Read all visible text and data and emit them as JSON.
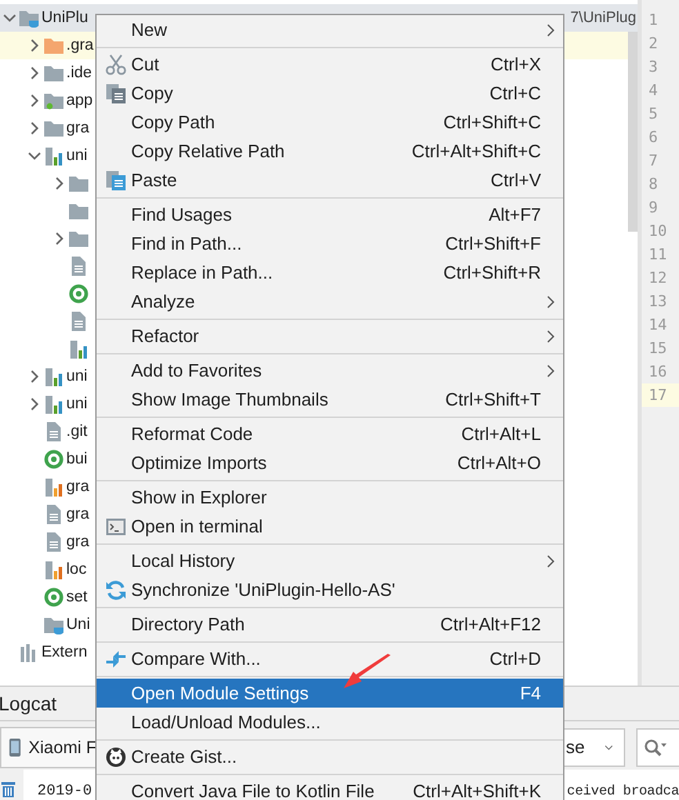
{
  "project_tree": {
    "items": [
      {
        "label": "UniPlu",
        "path_tail": "7\\UniPlug",
        "kind": "folder-cup",
        "expanded": true,
        "selected": true,
        "highlighted": false,
        "children": [
          {
            "label": ".gra",
            "kind": "folder-orange",
            "expanded": false,
            "selected": false,
            "highlighted": true
          },
          {
            "label": ".ide",
            "kind": "folder",
            "expanded": false,
            "selected": false,
            "highlighted": false
          },
          {
            "label": "app",
            "kind": "folder-app",
            "expanded": false,
            "selected": false,
            "highlighted": false
          },
          {
            "label": "gra",
            "kind": "folder",
            "expanded": false,
            "selected": false,
            "highlighted": false
          },
          {
            "label": "uni",
            "kind": "module",
            "expanded": true,
            "selected": false,
            "highlighted": false,
            "children": [
              {
                "kind": "folder",
                "expanded": false,
                "selected": false,
                "highlighted": false
              },
              {
                "kind": "folder",
                "selected": false,
                "highlighted": false
              },
              {
                "kind": "folder",
                "expanded": false,
                "selected": false,
                "highlighted": false
              },
              {
                "kind": "file",
                "selected": false,
                "highlighted": false
              },
              {
                "kind": "gradle",
                "selected": false,
                "highlighted": false
              },
              {
                "kind": "file",
                "selected": false,
                "highlighted": false
              },
              {
                "kind": "module",
                "selected": false,
                "highlighted": false
              }
            ]
          },
          {
            "label": "uni",
            "kind": "module",
            "expanded": false,
            "selected": false,
            "highlighted": false
          },
          {
            "label": "uni",
            "kind": "module",
            "expanded": false,
            "selected": false,
            "highlighted": false
          },
          {
            "label": ".git",
            "kind": "file",
            "selected": false,
            "highlighted": false
          },
          {
            "label": "bui",
            "kind": "gradle",
            "selected": false,
            "highlighted": false
          },
          {
            "label": "gra",
            "kind": "bars-orange",
            "selected": false,
            "highlighted": false
          },
          {
            "label": "gra",
            "kind": "file",
            "selected": false,
            "highlighted": false
          },
          {
            "label": "gra",
            "kind": "file",
            "selected": false,
            "highlighted": false
          },
          {
            "label": "loc",
            "kind": "bars-orange",
            "selected": false,
            "highlighted": false
          },
          {
            "label": "set",
            "kind": "gradle",
            "selected": false,
            "highlighted": false
          },
          {
            "label": "Uni",
            "kind": "folder-cup",
            "selected": false,
            "highlighted": false
          }
        ]
      },
      {
        "label": "Extern",
        "kind": "library",
        "selected": false,
        "highlighted": false
      }
    ]
  },
  "line_numbers": [
    {
      "number": "1",
      "current": false
    },
    {
      "number": "2",
      "current": false
    },
    {
      "number": "3",
      "current": false
    },
    {
      "number": "4",
      "current": false
    },
    {
      "number": "5",
      "current": false
    },
    {
      "number": "6",
      "current": false
    },
    {
      "number": "7",
      "current": false
    },
    {
      "number": "8",
      "current": false
    },
    {
      "number": "9",
      "current": false
    },
    {
      "number": "10",
      "current": false
    },
    {
      "number": "11",
      "current": false
    },
    {
      "number": "12",
      "current": false
    },
    {
      "number": "13",
      "current": false
    },
    {
      "number": "14",
      "current": false
    },
    {
      "number": "15",
      "current": false
    },
    {
      "number": "16",
      "current": false
    },
    {
      "number": "17",
      "current": true
    }
  ],
  "logcat": {
    "title": "Logcat",
    "device": "Xiaomi F",
    "filter": "se",
    "log_line": {
      "start": "2019-0",
      "end": "ceived broadca"
    }
  },
  "context_menu": {
    "groups": [
      [
        {
          "label": "New",
          "submenu": true,
          "selected": false
        }
      ],
      [
        {
          "label": "Cut",
          "shortcut": "Ctrl+X",
          "kind": "scissors",
          "submenu": false,
          "selected": false
        },
        {
          "label": "Copy",
          "shortcut": "Ctrl+C",
          "kind": "copy",
          "submenu": false,
          "selected": false
        },
        {
          "label": "Copy Path",
          "shortcut": "Ctrl+Shift+C",
          "submenu": false,
          "selected": false
        },
        {
          "label": "Copy Relative Path",
          "shortcut": "Ctrl+Alt+Shift+C",
          "submenu": false,
          "selected": false
        },
        {
          "label": "Paste",
          "shortcut": "Ctrl+V",
          "kind": "paste",
          "submenu": false,
          "selected": false
        }
      ],
      [
        {
          "label": "Find Usages",
          "shortcut": "Alt+F7",
          "submenu": false,
          "selected": false
        },
        {
          "label": "Find in Path...",
          "shortcut": "Ctrl+Shift+F",
          "submenu": false,
          "selected": false
        },
        {
          "label": "Replace in Path...",
          "shortcut": "Ctrl+Shift+R",
          "submenu": false,
          "selected": false
        },
        {
          "label": "Analyze",
          "submenu": true,
          "selected": false
        }
      ],
      [
        {
          "label": "Refactor",
          "submenu": true,
          "selected": false
        }
      ],
      [
        {
          "label": "Add to Favorites",
          "submenu": true,
          "selected": false
        },
        {
          "label": "Show Image Thumbnails",
          "shortcut": "Ctrl+Shift+T",
          "submenu": false,
          "selected": false
        }
      ],
      [
        {
          "label": "Reformat Code",
          "shortcut": "Ctrl+Alt+L",
          "submenu": false,
          "selected": false
        },
        {
          "label": "Optimize Imports",
          "shortcut": "Ctrl+Alt+O",
          "submenu": false,
          "selected": false
        }
      ],
      [
        {
          "label": "Show in Explorer",
          "submenu": false,
          "selected": false
        },
        {
          "label": "Open in terminal",
          "kind": "terminal",
          "submenu": false,
          "selected": false
        }
      ],
      [
        {
          "label": "Local History",
          "submenu": true,
          "selected": false
        },
        {
          "label": "Synchronize 'UniPlugin-Hello-AS'",
          "kind": "sync",
          "submenu": false,
          "selected": false
        }
      ],
      [
        {
          "label": "Directory Path",
          "shortcut": "Ctrl+Alt+F12",
          "submenu": false,
          "selected": false
        }
      ],
      [
        {
          "label": "Compare With...",
          "shortcut": "Ctrl+D",
          "kind": "compare",
          "submenu": false,
          "selected": false
        }
      ],
      [
        {
          "label": "Open Module Settings",
          "shortcut": "F4",
          "submenu": false,
          "selected": true
        },
        {
          "label": "Load/Unload Modules...",
          "submenu": false,
          "selected": false
        }
      ],
      [
        {
          "label": "Create Gist...",
          "kind": "cat",
          "submenu": false,
          "selected": false
        }
      ],
      [
        {
          "label": "Convert Java File to Kotlin File",
          "shortcut": "Ctrl+Alt+Shift+K",
          "submenu": false,
          "selected": false
        }
      ]
    ]
  }
}
